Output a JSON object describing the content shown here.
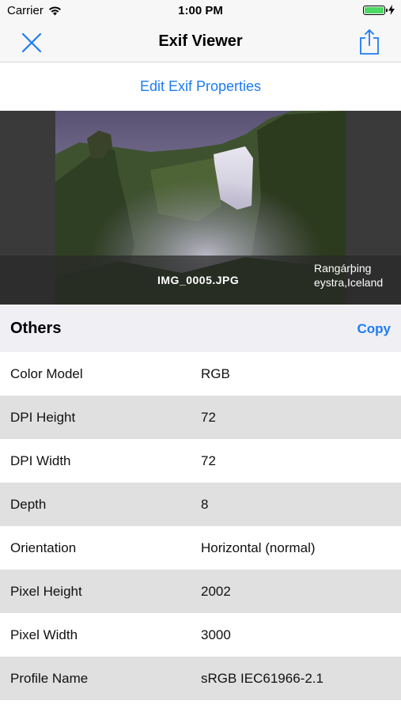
{
  "status": {
    "carrier": "Carrier",
    "time": "1:00 PM",
    "battery_level": 1.0
  },
  "nav": {
    "title": "Exif Viewer",
    "left_icon": "close-icon",
    "right_icon": "share-icon"
  },
  "edit_link": "Edit Exif Properties",
  "photo": {
    "filename": "IMG_0005.JPG",
    "location": "Rangárþing eystra,Iceland"
  },
  "section": {
    "title": "Others",
    "copy_label": "Copy"
  },
  "rows": [
    {
      "key": "Color Model",
      "value": "RGB"
    },
    {
      "key": "DPI Height",
      "value": "72"
    },
    {
      "key": "DPI Width",
      "value": "72"
    },
    {
      "key": "Depth",
      "value": "8"
    },
    {
      "key": "Orientation",
      "value": "Horizontal (normal)"
    },
    {
      "key": "Pixel Height",
      "value": "2002"
    },
    {
      "key": "Pixel Width",
      "value": "3000"
    },
    {
      "key": "Profile Name",
      "value": "sRGB IEC61966-2.1"
    }
  ],
  "colors": {
    "accent": "#1c7cf4",
    "row_alt": "#e0e0e0",
    "header_bg": "#efeff4"
  }
}
